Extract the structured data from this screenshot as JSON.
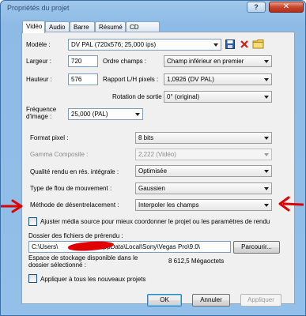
{
  "window": {
    "title": "Propriétés du projet",
    "help_label": "?",
    "close_label": "✕"
  },
  "tabs": [
    "Vidéo",
    "Audio",
    "Barre",
    "Résumé",
    "CD audio"
  ],
  "model": {
    "label": "Modèle :",
    "value": "DV PAL (720x576; 25,000 ips)",
    "icons": [
      "save-icon",
      "delete-icon",
      "folder-icon"
    ]
  },
  "width": {
    "label": "Largeur :",
    "value": "720"
  },
  "height": {
    "label": "Hauteur :",
    "value": "576"
  },
  "field_order": {
    "label": "Ordre champs :",
    "value": "Champ inférieur en premier"
  },
  "aspect_ratio": {
    "label": "Rapport L/H pixels :",
    "value": "1,0926 (DV PAL)"
  },
  "rotation": {
    "label": "Rotation de sortie :",
    "value": "0° (original)"
  },
  "frame_rate": {
    "label_line1": "Fréquence",
    "label_line2": "d'image :",
    "value": "25,000 (PAL)"
  },
  "pixel_format": {
    "label": "Format pixel :",
    "value": "8 bits"
  },
  "gamma": {
    "label": "Gamma Composite :",
    "value": "2,222 (Vidéo)"
  },
  "render_quality": {
    "label": "Qualité rendu en rés. intégrale :",
    "value": "Optimisée"
  },
  "motion_blur": {
    "label": "Type de flou de mouvement :",
    "value": "Gaussien"
  },
  "deinterlace": {
    "label": "Méthode de désentrelacement :",
    "value": "Interpoler les champs"
  },
  "adjust_media": {
    "label": "Ajuster média source pour mieux coordonner le projet ou les paramètres de rendu",
    "checked": false
  },
  "prerender": {
    "label": "Dossier des fichiers de prérendu :",
    "path_start": "C:\\Users\\",
    "path_end": "AppData\\Local\\Sony\\Vegas Pro\\9.0\\",
    "browse_label": "Parcourir...",
    "space_label_line1": "Espace de stockage disponible dans le",
    "space_label_line2": "dossier sélectionné :",
    "space_value": "8 612,5 Mégaoctets"
  },
  "apply_all": {
    "label": "Appliquer à tous les nouveaux projets",
    "checked": false
  },
  "buttons": {
    "ok": "OK",
    "cancel": "Annuler",
    "apply": "Appliquer"
  },
  "colors": {
    "annotation_red": "#e10000",
    "titlebar": "#9fc7ea",
    "dialog_bg": "#f0f0f0"
  }
}
